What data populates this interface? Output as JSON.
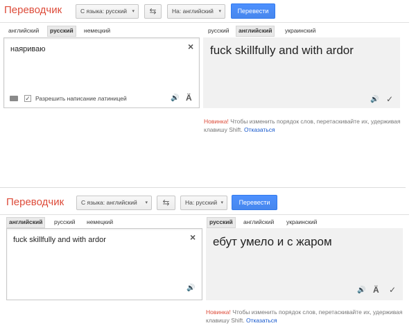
{
  "panels": [
    {
      "title": "Переводчик",
      "from_button": "С языка: русский",
      "to_button": "На: английский",
      "translate_button": "Перевести",
      "source_tabs": [
        "английский",
        "русский",
        "немецкий"
      ],
      "source_active": 1,
      "target_tabs": [
        "русский",
        "английский",
        "украинский"
      ],
      "target_active": 1,
      "source_text": "наяриваю",
      "latin_label": "Разрешить написание латиницей",
      "translation": "fuck skillfully and with ardor",
      "notice_new": "Новинка!",
      "notice_text": " Чтобы изменить порядок слов, перетаскивайте их, удерживая клавишу Shift. ",
      "notice_link": "Отказаться"
    },
    {
      "title": "Переводчик",
      "from_button": "С языка: английский",
      "to_button": "На: русский",
      "translate_button": "Перевести",
      "source_tabs": [
        "английский",
        "русский",
        "немецкий"
      ],
      "source_active": 0,
      "target_tabs": [
        "русский",
        "английский",
        "украинский"
      ],
      "target_active": 0,
      "source_text": "fuck skillfully and with ardor",
      "translation": "ебут умело и с жаром",
      "notice_new": "Новинка!",
      "notice_text": " Чтобы изменить порядок слов, перетаскивайте их, удерживая клавишу Shift. ",
      "notice_link": "Отказаться"
    }
  ],
  "icons": {
    "swap": "⇆",
    "caret": "▾",
    "close": "×",
    "speaker": "🔊",
    "transliterate": "Ä",
    "check": "✓"
  }
}
